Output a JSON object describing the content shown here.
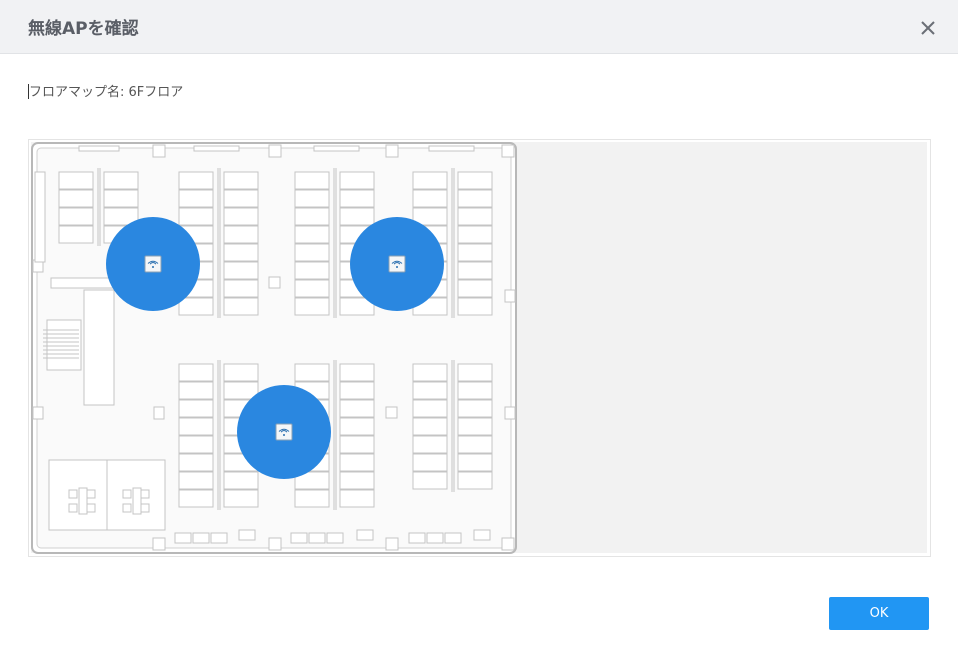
{
  "dialog": {
    "title": "無線APを確認",
    "floor_map_label": "フロアマップ名: 6Fフロア",
    "ok_label": "OK"
  },
  "colors": {
    "accent": "#2196f3",
    "ap_marker": "#2a87e0"
  },
  "map": {
    "access_points": [
      {
        "name": "access-point-1",
        "icon": "wifi-icon"
      },
      {
        "name": "access-point-2",
        "icon": "wifi-icon"
      },
      {
        "name": "access-point-3",
        "icon": "wifi-icon"
      }
    ]
  }
}
